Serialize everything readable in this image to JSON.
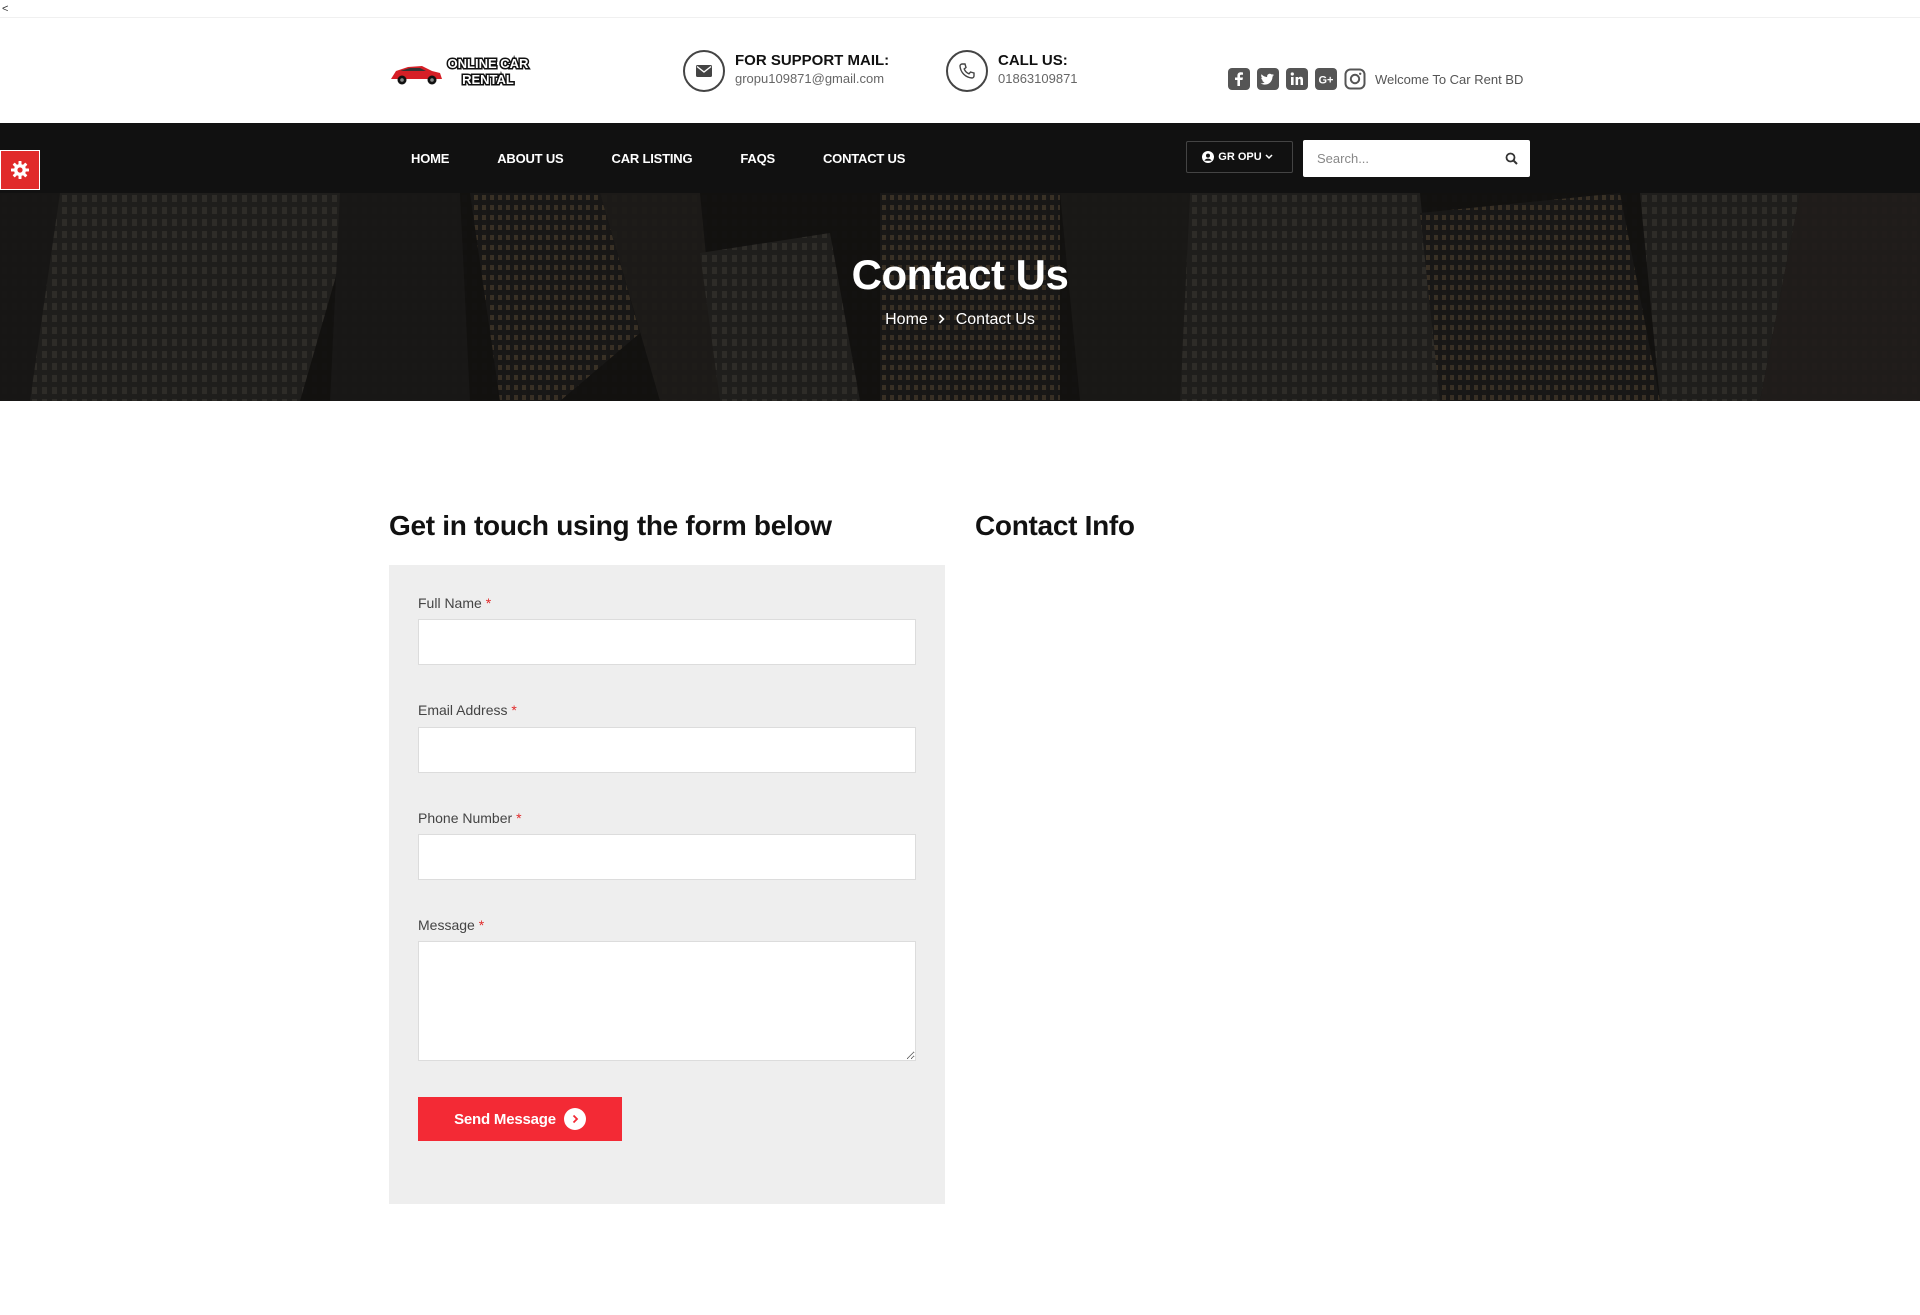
{
  "back_link": "<",
  "header": {
    "logo_text_line1": "ONLINE CAR",
    "logo_text_line2": "RENTAL",
    "support": {
      "label": "FOR SUPPORT MAIL:",
      "value": "gropu109871@gmail.com",
      "icon": "envelope-icon"
    },
    "call": {
      "label": "CALL US:",
      "value": "01863109871",
      "icon": "phone-icon"
    },
    "social_icons": [
      "facebook-icon",
      "twitter-icon",
      "linkedin-icon",
      "google-plus-icon",
      "instagram-icon"
    ],
    "welcome": "Welcome To Car Rent BD"
  },
  "nav": {
    "items": [
      {
        "label": "HOME"
      },
      {
        "label": "ABOUT US"
      },
      {
        "label": "CAR LISTING"
      },
      {
        "label": "FAQS"
      },
      {
        "label": "CONTACT US"
      }
    ],
    "user_label": "GR OPU",
    "search_placeholder": "Search..."
  },
  "hero": {
    "title": "Contact Us",
    "breadcrumb_home": "Home",
    "breadcrumb_current": "Contact Us"
  },
  "form": {
    "title": "Get in touch using the form below",
    "fields": {
      "full_name": {
        "label": "Full Name",
        "value": ""
      },
      "email": {
        "label": "Email Address",
        "value": ""
      },
      "phone": {
        "label": "Phone Number",
        "value": ""
      },
      "message": {
        "label": "Message",
        "value": ""
      }
    },
    "required_mark": "*",
    "submit_label": "Send Message"
  },
  "contact_info": {
    "title": "Contact Info"
  },
  "colors": {
    "accent": "#f32a35",
    "nav_bg": "#111111",
    "panel_bg": "#eeeeee"
  }
}
